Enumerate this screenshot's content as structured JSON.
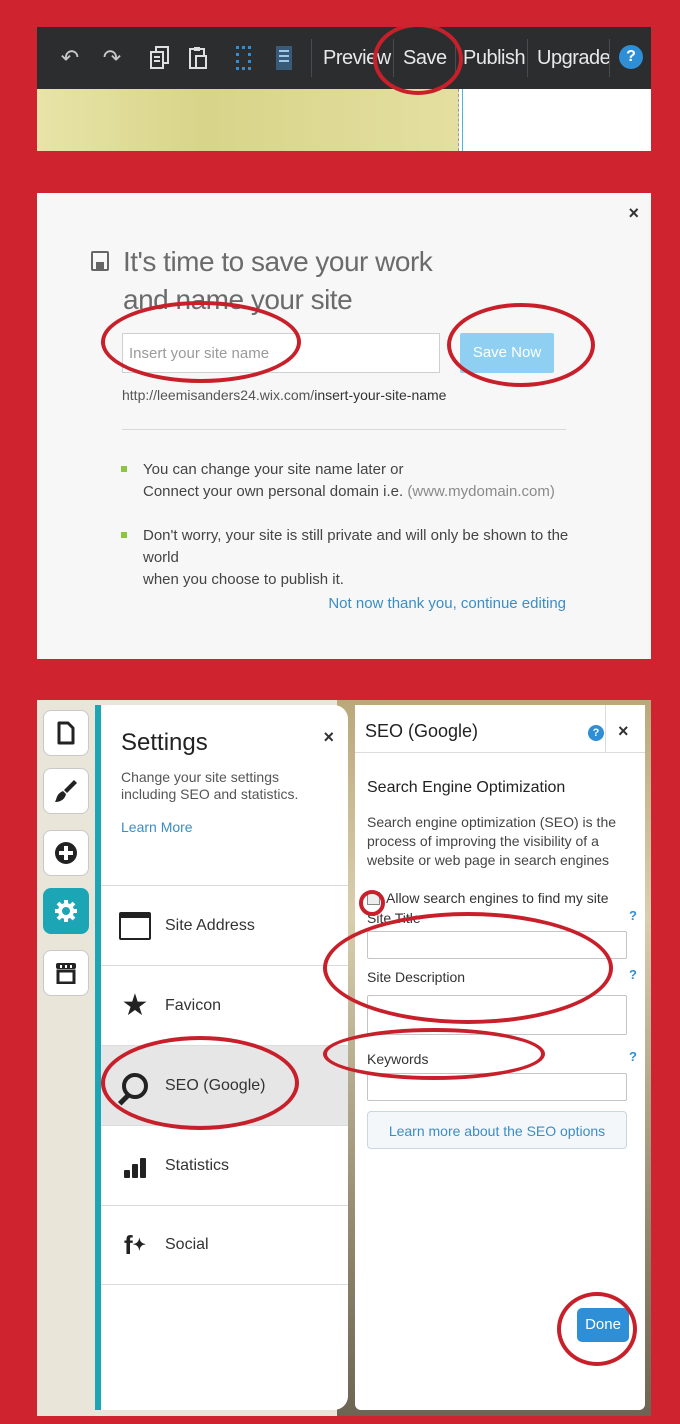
{
  "toolbar": {
    "preview_label": "Preview",
    "save_label": "Save",
    "publish_label": "Publish",
    "upgrade_label": "Upgrade",
    "help_label": "?",
    "icons": [
      "undo-icon",
      "redo-icon",
      "copy-icon",
      "paste-icon",
      "grid-icon",
      "layers-icon"
    ]
  },
  "save_dialog": {
    "close_label": "×",
    "title_line1": "It's time to save your work",
    "title_line2": "and name your site",
    "site_name_placeholder": "Insert your site name",
    "save_now_label": "Save Now",
    "url_prefix": "http://leemisanders24.wix.com/",
    "url_slug": "insert-your-site-name",
    "bullet1_line1": "You can change your site name later or",
    "bullet1_line2_text": "Connect your own personal domain i.e. ",
    "bullet1_line2_example": "(www.mydomain.com)",
    "bullet2_line1": "Don't worry, your site is still private and will only be shown to the world",
    "bullet2_line2": "when you choose to publish it.",
    "not_now_label": "Not now thank you, continue editing"
  },
  "settings": {
    "title": "Settings",
    "close_label": "×",
    "description": "Change your site settings including SEO and statistics.",
    "learn_more_label": "Learn More",
    "items": [
      {
        "label": "Site Address"
      },
      {
        "label": "Favicon"
      },
      {
        "label": "SEO (Google)"
      },
      {
        "label": "Statistics"
      },
      {
        "label": "Social"
      }
    ],
    "selected_item": "SEO (Google)"
  },
  "seo": {
    "title": "SEO (Google)",
    "help_label": "?",
    "close_label": "×",
    "heading": "Search Engine Optimization",
    "description": "Search engine optimization (SEO) is the process of improving the visibility of a website or web page in search engines",
    "allow_label": "Allow search engines to find my site",
    "site_title_label": "Site Title",
    "site_description_label": "Site Description",
    "keywords_label": "Keywords",
    "field_help": "?",
    "learn_more_label": "Learn more about the SEO options",
    "done_label": "Done"
  },
  "colors": {
    "frame_red": "#cf2430",
    "toolbar_bg": "#2c2d2f",
    "accent_teal": "#1ba5b5",
    "link_blue": "#3c8dc5",
    "save_now_blue": "#8fd0f2",
    "done_blue": "#2f8fd6",
    "bullet_green": "#8cc63f"
  }
}
